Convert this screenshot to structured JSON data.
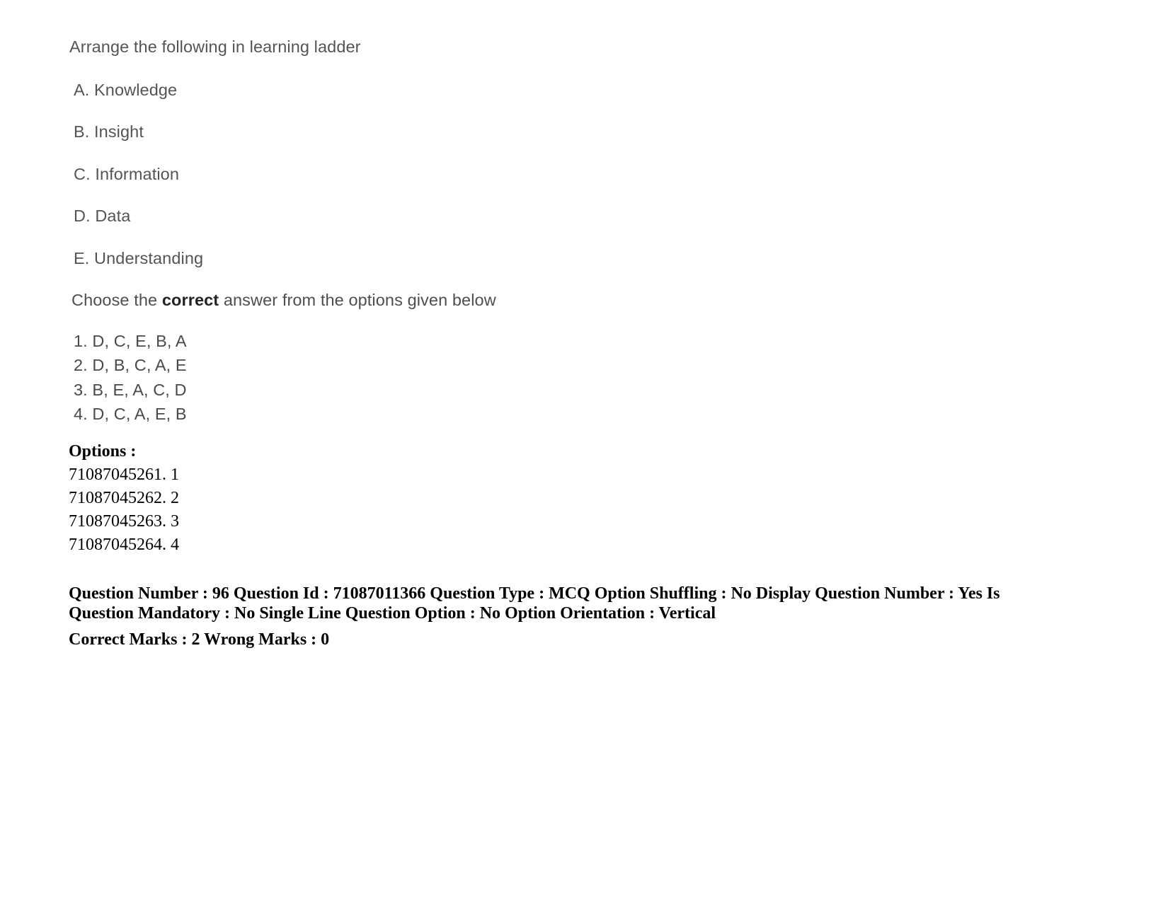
{
  "document": {
    "type": "exam-question-paper",
    "background_color": "#ffffff",
    "scanned_text_color": "#545454"
  },
  "question_scan": {
    "stem": "Arrange the following in learning ladder",
    "items": [
      "A. Knowledge",
      "B. Insight",
      "C. Information",
      "D. Data",
      "E. Understanding"
    ],
    "instruction_prefix": "Choose the ",
    "instruction_bold": "correct",
    "instruction_suffix": " answer from the options given below",
    "answer_choices": [
      "1. D, C, E, B, A",
      "2. D, B, C, A, E",
      "3. B, E, A, C, D",
      "4. D, C, A, E, B"
    ]
  },
  "options_section": {
    "heading": "Options :",
    "rows": [
      "71087045261. 1",
      "71087045262. 2",
      "71087045263. 3",
      "71087045264. 4"
    ]
  },
  "metadata": {
    "line1": "Question Number : 96 Question Id : 71087011366 Question Type : MCQ Option Shuffling : No Display Question Number : Yes Is Question Mandatory : No Single Line Question Option : No Option Orientation : Vertical",
    "line2": "Correct Marks : 2 Wrong Marks : 0",
    "fields": {
      "question_number": "96",
      "question_id": "71087011366",
      "question_type": "MCQ",
      "option_shuffling": "No",
      "display_question_number": "Yes",
      "is_question_mandatory": "No",
      "single_line_question_option": "No",
      "option_orientation": "Vertical",
      "correct_marks": "2",
      "wrong_marks": "0"
    }
  }
}
